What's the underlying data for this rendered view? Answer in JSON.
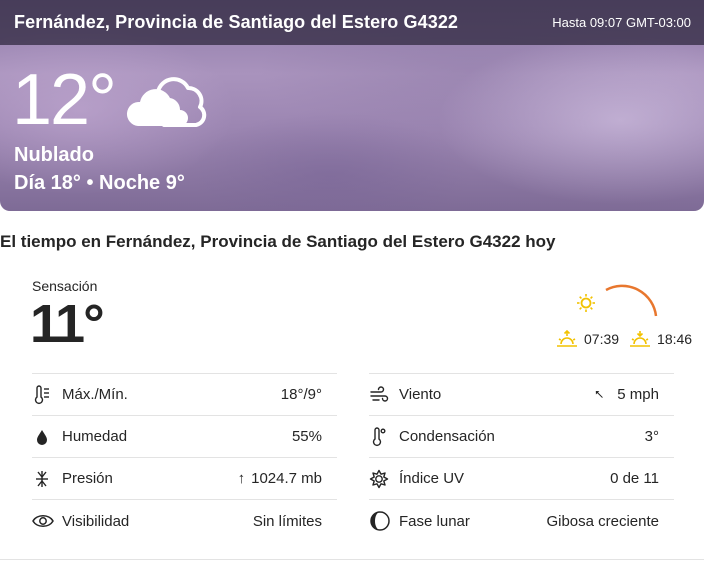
{
  "header": {
    "location": "Fernández, Provincia de Santiago del Estero G4322",
    "valid_until": "Hasta 09:07 GMT-03:00"
  },
  "current": {
    "temperature": "12°",
    "icon": "cloudy-icon",
    "phrase": "Nublado",
    "day_night": "Día 18° • Noche 9°"
  },
  "today": {
    "title": "El tiempo en Fernández, Provincia de Santiago del Estero G4322 hoy",
    "feels_like_label": "Sensación",
    "feels_like_value": "11°",
    "sunrise": "07:39",
    "sunset": "18:46",
    "arc_color": "#e8772e",
    "sun_color": "#f2c200"
  },
  "details_left": [
    {
      "icon": "thermometer-icon",
      "label": "Máx./Mín.",
      "value": "18°/9°"
    },
    {
      "icon": "humidity-drop-icon",
      "label": "Humedad",
      "value": "55%"
    },
    {
      "icon": "pressure-icon",
      "label": "Presión",
      "value": "1024.7 mb",
      "trend": "↑"
    },
    {
      "icon": "visibility-eye-icon",
      "label": "Visibilidad",
      "value": "Sin límites"
    }
  ],
  "details_right": [
    {
      "icon": "wind-icon",
      "label": "Viento",
      "value": "5 mph",
      "direction": "⭦"
    },
    {
      "icon": "dew-point-icon",
      "label": "Condensación",
      "value": "3°"
    },
    {
      "icon": "uv-index-icon",
      "label": "Índice UV",
      "value": "0 de 11"
    },
    {
      "icon": "moon-phase-icon",
      "label": "Fase lunar",
      "value": "Gibosa creciente"
    }
  ]
}
